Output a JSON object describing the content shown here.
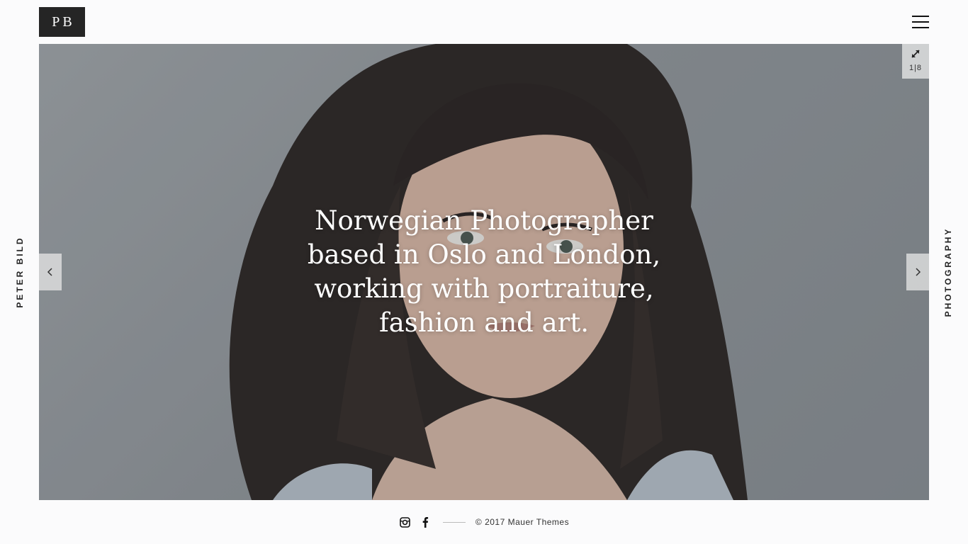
{
  "header": {
    "logo_text": "PB",
    "menu_icon": "hamburger-icon"
  },
  "sidebar_left": {
    "text": "PETER BILD"
  },
  "sidebar_right": {
    "text": "PHOTOGRAPHY"
  },
  "hero": {
    "caption": "Norwegian Photographer based in Oslo and London, working with portraiture, fashion and art.",
    "counter": "1|8",
    "expand_icon": "expand-icon",
    "prev_icon": "chevron-left-icon",
    "next_icon": "chevron-right-icon"
  },
  "footer": {
    "social": [
      "instagram-icon",
      "facebook-icon"
    ],
    "copyright": "© 2017 Mauer Themes"
  },
  "colors": {
    "background": "#fbfbfc",
    "logo_bg": "#252525",
    "text_dark": "#222222"
  }
}
